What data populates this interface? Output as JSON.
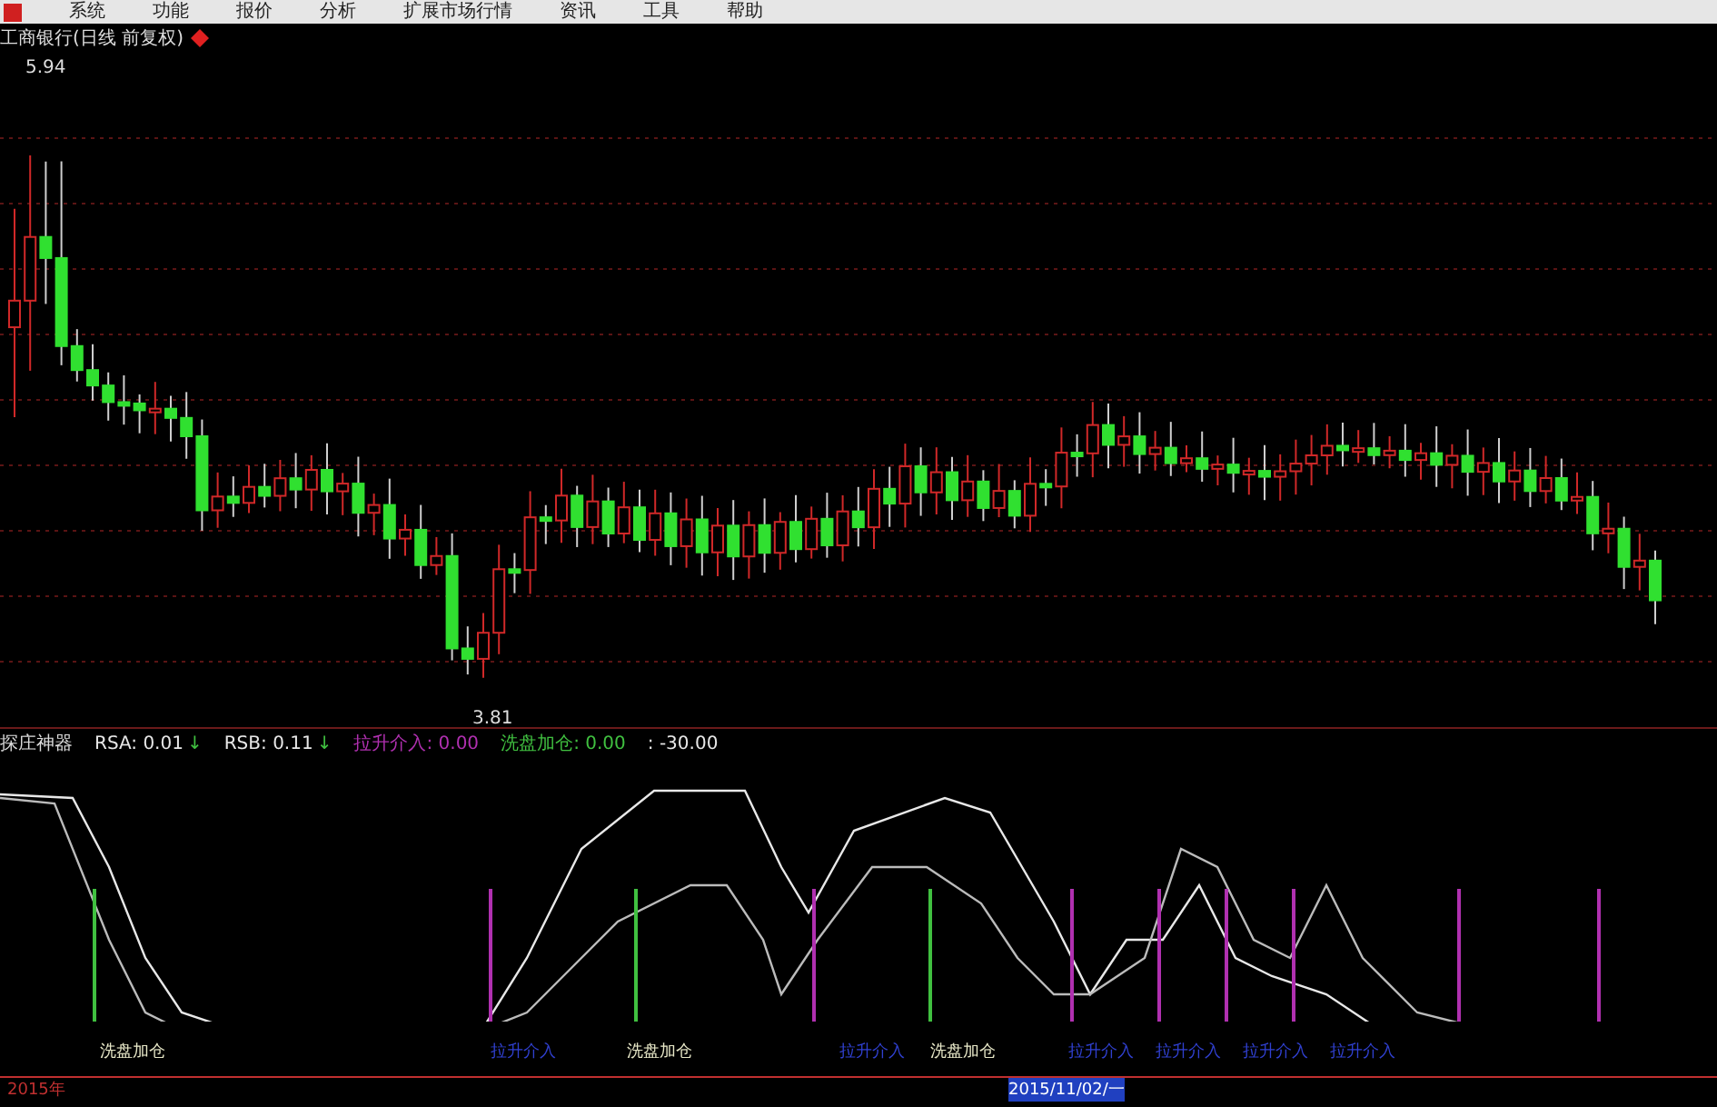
{
  "menu": [
    {
      "label": "系统",
      "selected": false
    },
    {
      "label": "功能",
      "selected": false
    },
    {
      "label": "报价",
      "selected": false
    },
    {
      "label": "分析",
      "selected": false
    },
    {
      "label": "扩展市场行情",
      "selected": false
    },
    {
      "label": "资讯",
      "selected": false
    },
    {
      "label": "工具",
      "selected": false
    },
    {
      "label": "帮助",
      "selected": false
    }
  ],
  "stock_title": "工商银行(日线 前复权)",
  "price_high": "5.94",
  "price_low": "3.81",
  "indicator": {
    "name": "探庄神器",
    "readouts": [
      {
        "text": "RSA: 0.01",
        "arrow": "↓",
        "color": "#e8e8e8"
      },
      {
        "text": "RSB: 0.11",
        "arrow": "↓",
        "color": "#e8e8e8"
      },
      {
        "text": "拉升介入: 0.00",
        "color": "#b030b0"
      },
      {
        "text": "洗盘加仓: 0.00",
        "color": "#40c040"
      },
      {
        "text": ": -30.00",
        "color": "#e8e8e8"
      }
    ]
  },
  "signals": [
    {
      "kind": "wash",
      "label": "洗盘加仓"
    },
    {
      "kind": "pull",
      "label": "拉升介入"
    },
    {
      "kind": "wash",
      "label": "洗盘加仓"
    },
    {
      "kind": "pull",
      "label": "拉升介入"
    },
    {
      "kind": "wash",
      "label": "洗盘加仓"
    },
    {
      "kind": "pull",
      "label": "拉升介入"
    },
    {
      "kind": "pull",
      "label": "拉升介入"
    },
    {
      "kind": "pull",
      "label": "拉升介入"
    },
    {
      "kind": "pull",
      "label": "拉升介入"
    }
  ],
  "time_axis": [
    {
      "label": "2015年",
      "selected": false
    },
    {
      "label": "2015/11/02/一",
      "selected": true
    }
  ]
}
